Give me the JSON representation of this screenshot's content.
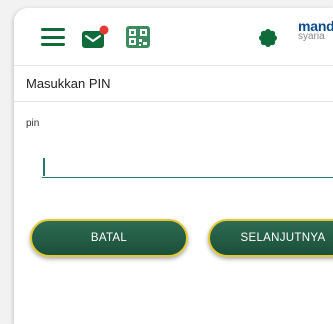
{
  "header": {
    "brand_line1": "mand",
    "brand_line2": "syaria",
    "icons": [
      "menu-icon",
      "mail-icon",
      "qr-code-icon",
      "flower-logo-icon"
    ],
    "colors": {
      "green": "#0f6b3a",
      "notification": "#e53935",
      "brand_blue": "#0b4a8b"
    }
  },
  "page": {
    "title": "Masukkan PIN"
  },
  "form": {
    "pin_label": "pin",
    "pin_value": ""
  },
  "buttons": {
    "cancel_label": "BATAL",
    "next_label": "SELANJUTNYA",
    "colors": {
      "fill": "#2e6b53",
      "border": "#e4c832"
    }
  }
}
